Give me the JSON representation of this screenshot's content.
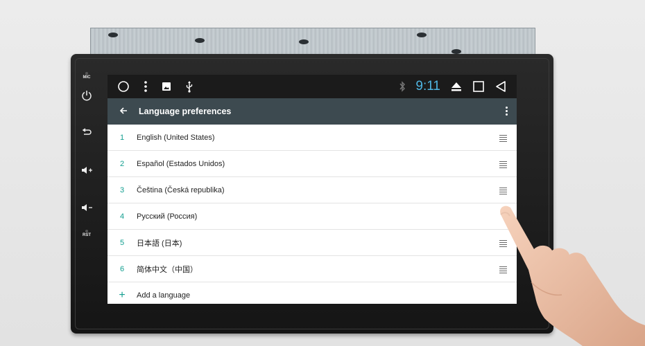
{
  "device": {
    "side_keys": [
      {
        "label": "MIC",
        "icon": "mic-icon"
      },
      {
        "label": "",
        "icon": "power-icon"
      },
      {
        "label": "",
        "icon": "back-arrow-icon"
      },
      {
        "label": "",
        "icon": "volume-up-icon"
      },
      {
        "label": "",
        "icon": "volume-down-icon"
      },
      {
        "label": "RST",
        "icon": "reset-icon"
      }
    ]
  },
  "statusbar": {
    "left_icons": [
      "home-circle-icon",
      "overflow-dots-icon",
      "image-notification-icon",
      "usb-icon"
    ],
    "bluetooth_icon": "bluetooth-icon",
    "clock": "9:11",
    "nav_icons": [
      "eject-icon",
      "recents-square-icon",
      "back-triangle-icon"
    ],
    "clock_color": "#4fb6e3"
  },
  "appbar": {
    "title": "Language preferences",
    "back_icon": "arrow-left-icon",
    "menu_icon": "more-vert-icon",
    "background": "#3d4a50"
  },
  "languages": [
    {
      "index": "1",
      "name": "English (United States)",
      "draggable": true
    },
    {
      "index": "2",
      "name": "Español (Estados Unidos)",
      "draggable": true
    },
    {
      "index": "3",
      "name": "Čeština (Česká republika)",
      "draggable": true
    },
    {
      "index": "4",
      "name": "Русский (Россия)",
      "draggable": false
    },
    {
      "index": "5",
      "name": "日本語 (日本)",
      "draggable": true
    },
    {
      "index": "6",
      "name": "简体中文（中国）",
      "draggable": true
    }
  ],
  "add_language": {
    "icon_text": "+",
    "label": "Add a language"
  },
  "accent_color": "#129e8f"
}
